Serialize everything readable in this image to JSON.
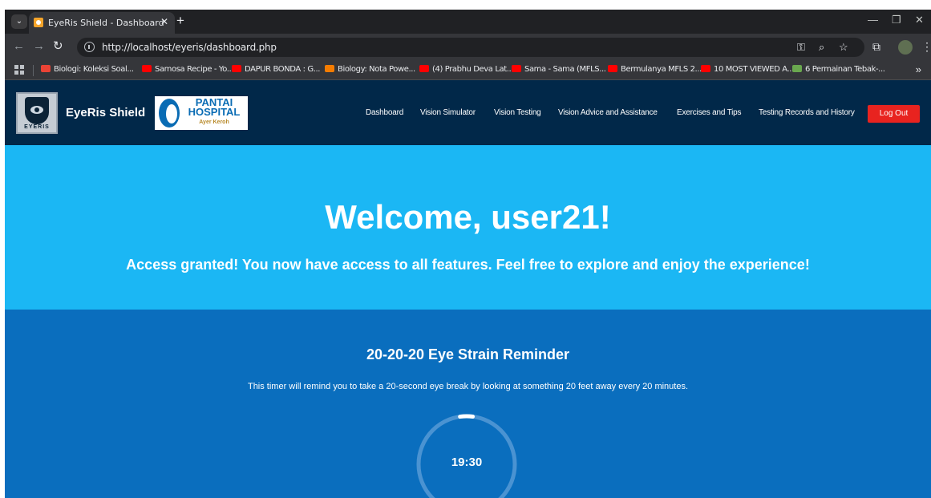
{
  "browser": {
    "tab_title": "EyeRis Shield - Dashboard",
    "url": "http://localhost/eyeris/dashboard.php",
    "bookmarks": [
      {
        "label": "Biologi: Koleksi Soal...",
        "color": "#ea4335"
      },
      {
        "label": "Samosa Recipe - Yo...",
        "color": "#ff0000"
      },
      {
        "label": "DAPUR BONDA : G...",
        "color": "#ff0000"
      },
      {
        "label": "Biology: Nota Powe...",
        "color": "#f57c00"
      },
      {
        "label": "(4) Prabhu Deva Lat...",
        "color": "#ff0000"
      },
      {
        "label": "Sama - Sama (MFLS...",
        "color": "#ff0000"
      },
      {
        "label": "Bermulanya MFLS 2...",
        "color": "#ff0000"
      },
      {
        "label": "10 MOST VIEWED A...",
        "color": "#ff0000"
      },
      {
        "label": "6 Permainan Tebak-...",
        "color": "#6aa84f"
      }
    ]
  },
  "site": {
    "logo_text": "EYERIS",
    "name": "EyeRis Shield",
    "hospital_name": "PANTAI HOSPITAL",
    "hospital_sub": "Ayer Keroh",
    "nav": [
      "Dashboard",
      "Vision Simulator",
      "Vision Testing",
      "Vision Advice and Assistance",
      "Exercises and Tips",
      "Testing Records and History"
    ],
    "logout_label": "Log Out"
  },
  "hero": {
    "title": "Welcome, user21!",
    "subtitle": "Access granted! You now have access to all features. Feel free to explore and enjoy the experience!"
  },
  "reminder": {
    "title": "20-20-20 Eye Strain Reminder",
    "description": "This timer will remind you to take a 20-second eye break by looking at something 20 feet away every 20 minutes.",
    "time": "19:30"
  },
  "colors": {
    "nav_bg": "#012849",
    "hero_bg": "#1bb7f4",
    "reminder_bg": "#0a6ebe",
    "logout_bg": "#e8231f"
  }
}
